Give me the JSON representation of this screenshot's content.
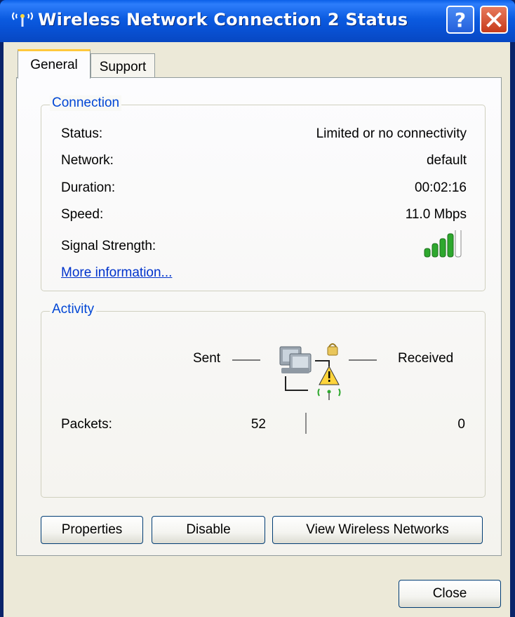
{
  "window": {
    "title": "Wireless Network Connection 2 Status"
  },
  "tabs": [
    {
      "label": "General",
      "selected": true
    },
    {
      "label": "Support",
      "selected": false
    }
  ],
  "connection": {
    "legend": "Connection",
    "rows": [
      {
        "label": "Status:",
        "value": "Limited or no connectivity"
      },
      {
        "label": "Network:",
        "value": "default"
      },
      {
        "label": "Duration:",
        "value": "00:02:16"
      },
      {
        "label": "Speed:",
        "value": "11.0 Mbps"
      }
    ],
    "signal_label": "Signal Strength:",
    "signal_bars_filled": 4,
    "signal_bars_total": 5,
    "more_info": "More information..."
  },
  "activity": {
    "legend": "Activity",
    "sent_label": "Sent",
    "received_label": "Received",
    "packets_label": "Packets:",
    "packets_sent": "52",
    "packets_received": "0"
  },
  "buttons": {
    "properties": "Properties",
    "disable": "Disable",
    "view_wireless": "View Wireless Networks",
    "close": "Close"
  },
  "icons": {
    "title": "wireless-connection-icon",
    "help": "help-icon",
    "close": "close-x-icon",
    "signal": "signal-strength-icon",
    "network": "network-warning-icon"
  },
  "colors": {
    "titlebar": "#0a5fe8",
    "legend_text": "#0046d5",
    "link": "#0033cc",
    "signal_bar": "#2ea82e",
    "close_button": "#c73b1b"
  }
}
